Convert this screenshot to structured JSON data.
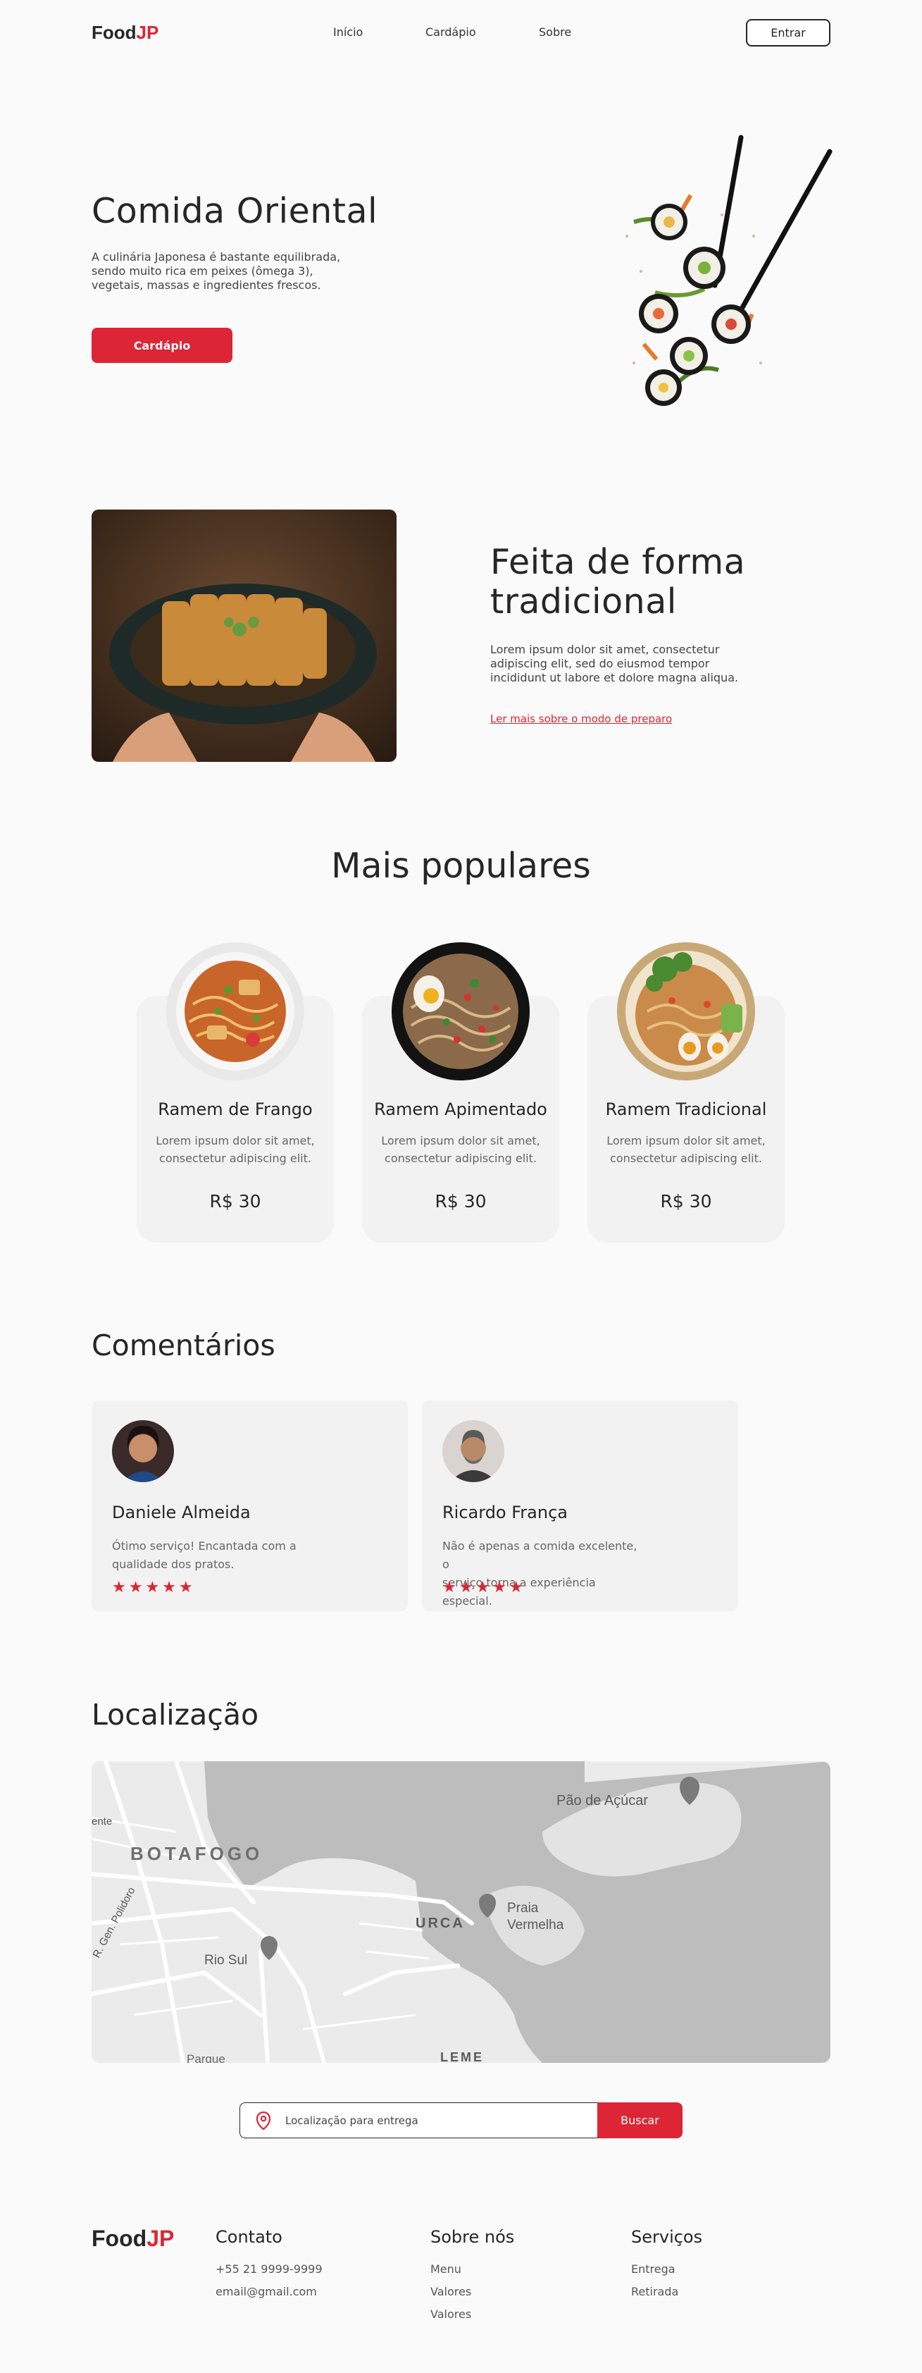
{
  "header": {
    "logo_main": "Food",
    "logo_accent": "JP",
    "nav": [
      "Início",
      "Cardápio",
      "Sobre"
    ],
    "login_label": "Entrar"
  },
  "hero": {
    "title": "Comida Oriental",
    "text_lines": [
      "A culinária Japonesa é bastante equilibrada,",
      "sendo muito rica em peixes (ômega 3),",
      "vegetais, massas e ingredientes frescos."
    ],
    "cta_label": "Cardápio"
  },
  "about": {
    "title_lines": [
      "Feita de forma",
      "tradicional"
    ],
    "text_lines": [
      "Lorem ipsum dolor sit amet, consectetur",
      "adipiscing elit, sed do eiusmod tempor",
      "incididunt ut labore et dolore magna aliqua."
    ],
    "link_label": "Ler mais sobre o modo de preparo"
  },
  "popular": {
    "title": "Mais populares",
    "items": [
      {
        "name": "Ramem de Frango",
        "desc_lines": [
          "Lorem ipsum dolor sit amet,",
          "consectetur adipiscing elit."
        ],
        "price": "R$ 30"
      },
      {
        "name": "Ramem Apimentado",
        "desc_lines": [
          "Lorem ipsum dolor sit amet,",
          "consectetur adipiscing elit."
        ],
        "price": "R$ 30"
      },
      {
        "name": "Ramem Tradicional",
        "desc_lines": [
          "Lorem ipsum dolor sit amet,",
          "consectetur adipiscing elit."
        ],
        "price": "R$ 30"
      }
    ]
  },
  "comments": {
    "title": "Comentários",
    "items": [
      {
        "name": "Daniele Almeida",
        "text_lines": [
          "Ótimo serviço! Encantada com a",
          "qualidade dos pratos."
        ],
        "stars": "★★★★★",
        "rating": 5
      },
      {
        "name": "Ricardo França",
        "text_lines": [
          "Não é apenas a comida excelente, o",
          "serviço torna a experiência especial."
        ],
        "stars": "★★★★★",
        "rating": 5
      }
    ]
  },
  "location": {
    "title": "Localização",
    "map_labels": {
      "botafogo": "BOTAFOGO",
      "urca": "URCA",
      "rio_sul": "Rio Sul",
      "praia_vermelha_1": "Praia",
      "praia_vermelha_2": "Vermelha",
      "pao_de_acucar": "Pão de Açúcar",
      "r_gen_polidoro": "R. Gen. Polidoro",
      "ente": "ente",
      "leme": "LEME",
      "parque": "Parque"
    },
    "search_placeholder": "Localização para entrega",
    "search_button": "Buscar"
  },
  "footer": {
    "logo_main": "Food",
    "logo_accent": "JP",
    "contact": {
      "title": "Contato",
      "phone": "+55 21 9999-9999",
      "email": "email@gmail.com"
    },
    "about": {
      "title": "Sobre nós",
      "links": [
        "Menu",
        "Valores",
        "Valores"
      ]
    },
    "services": {
      "title": "Serviços",
      "links": [
        "Entrega",
        "Retirada"
      ]
    }
  },
  "colors": {
    "accent": "#dc2535",
    "text": "#262626",
    "background": "#fafafa",
    "card": "#f2f2f2"
  }
}
